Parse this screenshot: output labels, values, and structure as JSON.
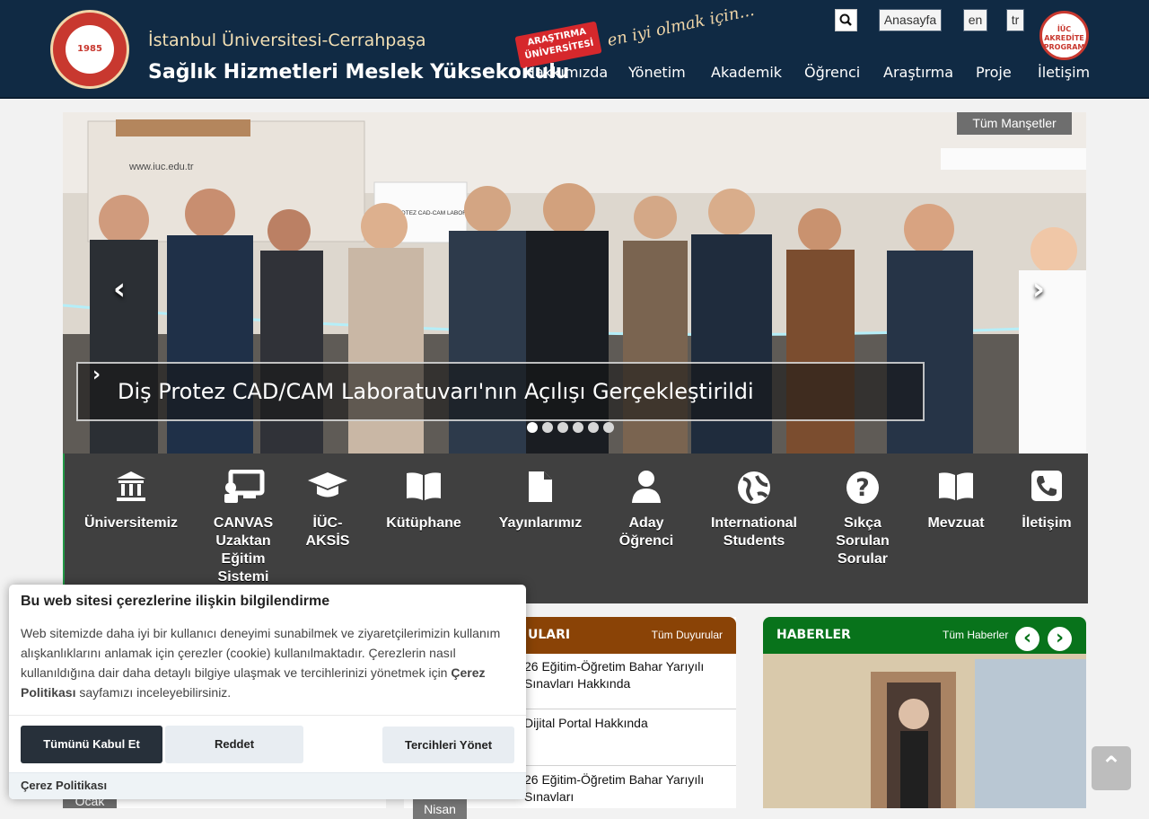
{
  "header": {
    "university": "İstanbul Üniversitesi-Cerrahpaşa",
    "school": "Sağlık Hizmetleri Meslek Yüksekokulu",
    "logo_year": "1985",
    "badge": "ARAŞTIRMA ÜNİVERSİTESİ",
    "slogan": "en iyi olmak için...",
    "top_links": [
      "Anasayfa",
      "en",
      "tr"
    ],
    "accreditation": "İÜC AKREDİTE PROGRAM",
    "nav": [
      "Hakkımızda",
      "Yönetim",
      "Akademik",
      "Öğrenci",
      "Araştırma",
      "Proje",
      "İletişim"
    ]
  },
  "slider": {
    "all_headlines": "Tüm Manşetler",
    "caption": "Diş Protez CAD/CAM Laboratuvarı'nın Açılışı Gerçekleştirildi",
    "sign_text": "DİŞ PROTEZ CAD-CAM LABORATUVARI",
    "url_text": "www.iuc.edu.tr",
    "dots": [
      true,
      false,
      false,
      false,
      false,
      false
    ]
  },
  "quick_links": [
    {
      "label": "Üniversitemiz",
      "icon": "university-icon"
    },
    {
      "label": "CANVAS Uzaktan Eğitim Sistemi",
      "icon": "presentation-icon"
    },
    {
      "label": "İÜC-AKSİS",
      "icon": "graduation-cap-icon"
    },
    {
      "label": "Kütüphane",
      "icon": "book-icon"
    },
    {
      "label": "Yayınlarımız",
      "icon": "file-icon"
    },
    {
      "label": "Aday Öğrenci",
      "icon": "user-icon"
    },
    {
      "label": "International Students",
      "icon": "globe-icon"
    },
    {
      "label": "Sıkça Sorulan Sorular",
      "icon": "question-icon"
    },
    {
      "label": "Mevzuat",
      "icon": "book-open-icon"
    },
    {
      "label": "İletişim",
      "icon": "phone-icon"
    }
  ],
  "announcements": {
    "title": "ULARI",
    "all": "Tüm Duyurular",
    "items": [
      {
        "text": "26 Eğitim-Öğretim Bahar Yarıyılı Sınavları Hakkında"
      },
      {
        "text": "Dijital Portal Hakkında"
      },
      {
        "text": "26 Eğitim-Öğretim Bahar Yarıyılı Sınavları",
        "month": "Nisan"
      }
    ]
  },
  "news": {
    "title": "HABERLER",
    "all": "Tüm Haberler"
  },
  "left_month": "Ocak",
  "cookie": {
    "title": "Bu web sitesi çerezlerine ilişkin bilgilendirme",
    "text": "Web sitemizde daha iyi bir kullanıcı deneyimi sunabilmek ve ziyaretçilerimizin kullanım alışkanlıklarını anlamak için çerezler (cookie) kullanılmaktadır. Çerezlerin nasıl kullanıldığına dair daha detaylı bilgiye ulaşmak ve tercihlerinizi yönetmek için ",
    "link": "Çerez Politikası",
    "suffix": " sayfamızı inceleyebilirsiniz.",
    "accept": "Tümünü Kabul Et",
    "reject": "Reddet",
    "manage": "Tercihleri Yönet",
    "footer": "Çerez Politikası"
  }
}
